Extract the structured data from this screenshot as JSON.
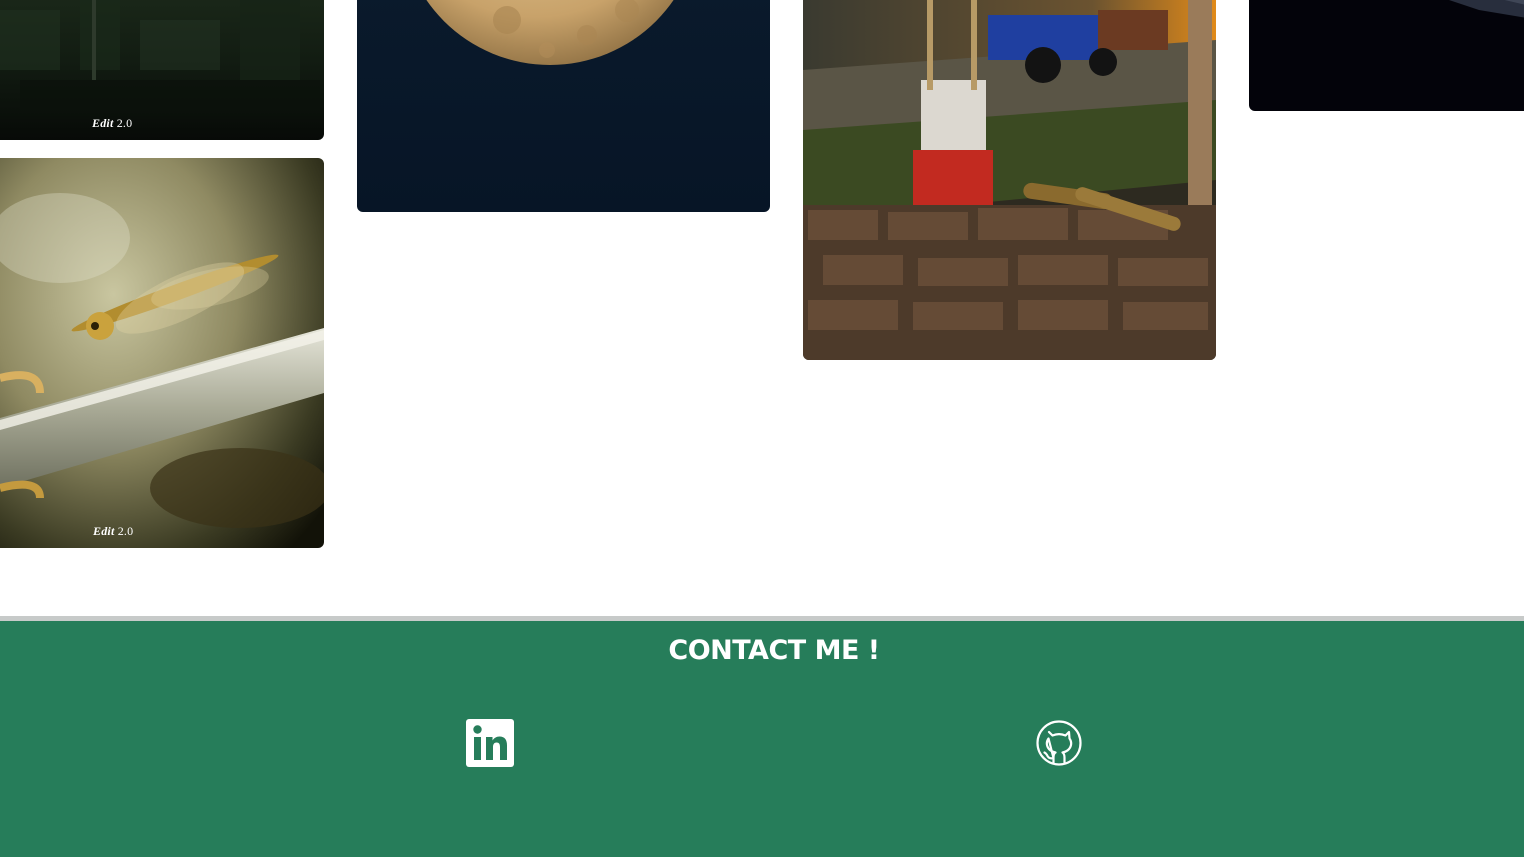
{
  "gallery": {
    "photos": [
      {
        "subject": "forest",
        "watermark": {
          "brand": "Edit",
          "version": "2.0"
        }
      },
      {
        "subject": "dragonfly",
        "watermark": {
          "brand": "Edit",
          "version": "2.0"
        }
      },
      {
        "subject": "moon"
      },
      {
        "subject": "street-tractor"
      },
      {
        "subject": "dark-sky"
      }
    ]
  },
  "footer": {
    "title": "CONTACT ME !",
    "background_color": "#267d5a",
    "links": [
      {
        "icon": "linkedin-icon"
      },
      {
        "icon": "github-icon"
      }
    ]
  }
}
